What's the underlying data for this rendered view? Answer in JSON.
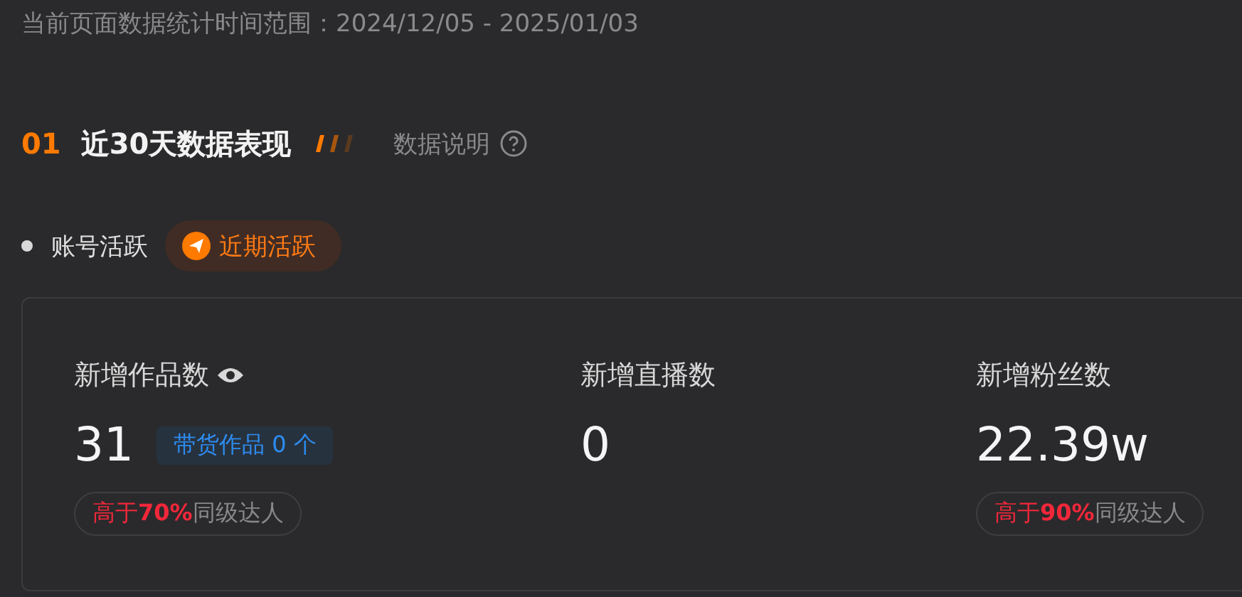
{
  "date_range": "当前页面数据统计时间范围：2024/12/05 - 2025/01/03",
  "section": {
    "number": "01",
    "title": "近30天数据表现",
    "help_link": "数据说明"
  },
  "account_activity": {
    "label": "账号活跃",
    "badge": "近期活跃"
  },
  "stats": [
    {
      "label": "新增作品数",
      "has_eye_icon": true,
      "value": "31",
      "tag": "带货作品 0 个",
      "compare_highlight": "高于**70%**",
      "compare_rest": "同级达人"
    },
    {
      "label": "新增直播数",
      "has_eye_icon": false,
      "value": "0"
    },
    {
      "label": "新增粉丝数",
      "has_eye_icon": false,
      "value": "22.39w",
      "compare_highlight": "高于**90%**",
      "compare_rest": "同级达人"
    }
  ]
}
